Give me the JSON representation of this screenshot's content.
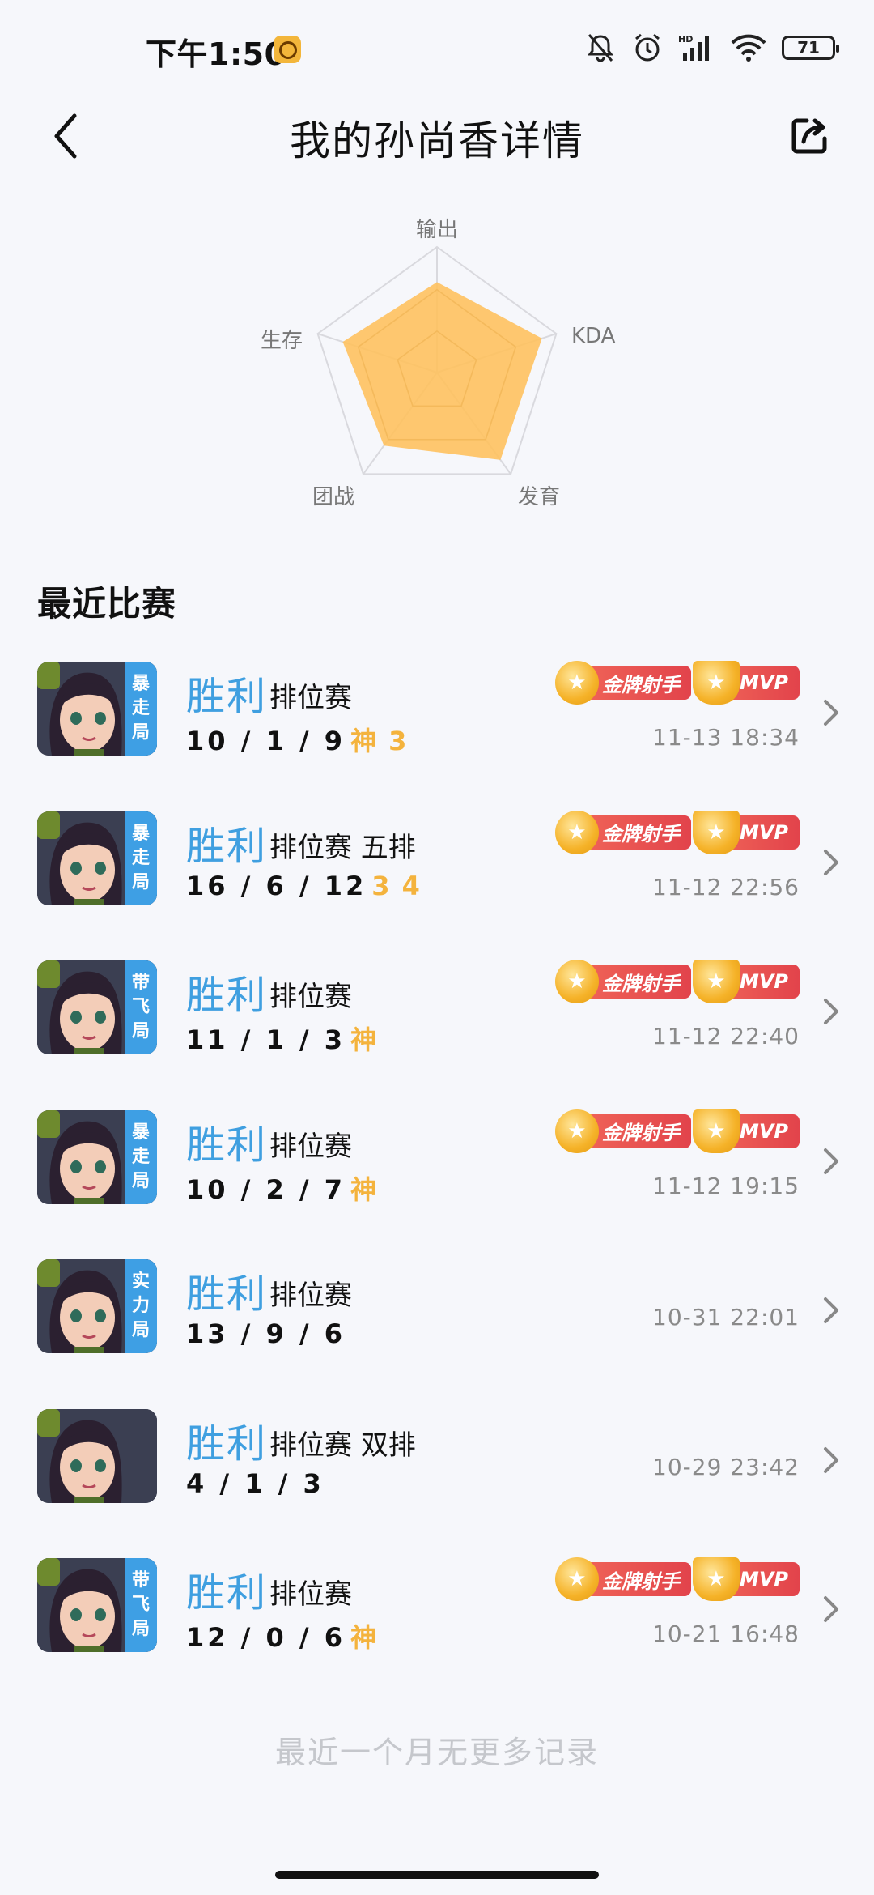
{
  "status_bar": {
    "time": "下午1:50",
    "battery": "71"
  },
  "header": {
    "title": "我的孙尚香详情"
  },
  "radar": {
    "labels": {
      "output": "输出",
      "kda": "KDA",
      "develop": "发育",
      "teamfight": "团战",
      "survival": "生存"
    },
    "values": {
      "output": 0.72,
      "kda": 0.88,
      "develop": 0.86,
      "teamfight": 0.72,
      "survival": 0.79
    },
    "fill_color": "#ffc05b"
  },
  "section": {
    "title": "最近比赛"
  },
  "matches": [
    {
      "tag": "暴走局",
      "result": "胜利",
      "mode": "排位赛",
      "kda": "10 / 1 / 9",
      "extra": "神 3",
      "badges": [
        "金牌射手",
        "MVP"
      ],
      "time": "11-13 18:34"
    },
    {
      "tag": "暴走局",
      "result": "胜利",
      "mode": "排位赛 五排",
      "kda": "16 / 6 / 12",
      "extra": "3 4",
      "badges": [
        "金牌射手",
        "MVP"
      ],
      "time": "11-12 22:56"
    },
    {
      "tag": "带飞局",
      "result": "胜利",
      "mode": "排位赛",
      "kda": "11 / 1 / 3",
      "extra": "神",
      "badges": [
        "金牌射手",
        "MVP"
      ],
      "time": "11-12 22:40"
    },
    {
      "tag": "暴走局",
      "result": "胜利",
      "mode": "排位赛",
      "kda": "10 / 2 / 7",
      "extra": "神",
      "badges": [
        "金牌射手",
        "MVP"
      ],
      "time": "11-12 19:15"
    },
    {
      "tag": "实力局",
      "result": "胜利",
      "mode": "排位赛",
      "kda": "13 / 9 / 6",
      "extra": "",
      "badges": [],
      "time": "10-31 22:01"
    },
    {
      "tag": "",
      "result": "胜利",
      "mode": "排位赛 双排",
      "kda": "4 / 1 / 3",
      "extra": "",
      "badges": [],
      "time": "10-29 23:42"
    },
    {
      "tag": "带飞局",
      "result": "胜利",
      "mode": "排位赛",
      "kda": "12 / 0 / 6",
      "extra": "神",
      "badges": [
        "金牌射手",
        "MVP"
      ],
      "time": "10-21 16:48"
    }
  ],
  "footer": {
    "note": "最近一个月无更多记录"
  }
}
